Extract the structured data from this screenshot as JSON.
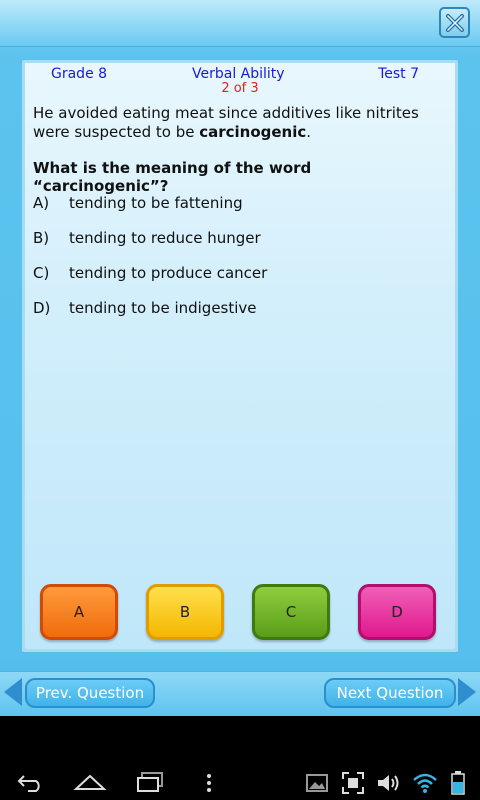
{
  "header": {
    "close_icon": "close-x-icon"
  },
  "meta": {
    "grade": "Grade 8",
    "subject": "Verbal Ability",
    "test": "Test 7",
    "progress": "2 of 3"
  },
  "passage": {
    "before": "He avoided eating meat since additives like nitrites were suspected to be ",
    "bold": "carcinogenic",
    "after": "."
  },
  "question": "What is the meaning of the word “carcinogenic”?",
  "options": [
    {
      "letter": "A)",
      "text": "tending to be fattening"
    },
    {
      "letter": "B)",
      "text": "tending to reduce hunger"
    },
    {
      "letter": "C)",
      "text": "tending to produce cancer"
    },
    {
      "letter": "D)",
      "text": "tending to be indigestive"
    }
  ],
  "answer_buttons": {
    "a": "A",
    "b": "B",
    "c": "C",
    "d": "D"
  },
  "nav": {
    "prev": "Prev. Question",
    "next": "Next Question"
  },
  "colors": {
    "accent": "#2f8ed0",
    "progress": "#e0211c",
    "meta": "#1a1ad6"
  },
  "system_icons": [
    "back-icon",
    "home-icon",
    "recent-apps-icon",
    "menu-dots-icon",
    "gallery-icon",
    "screenshot-icon",
    "volume-icon",
    "wifi-icon",
    "battery-icon"
  ]
}
